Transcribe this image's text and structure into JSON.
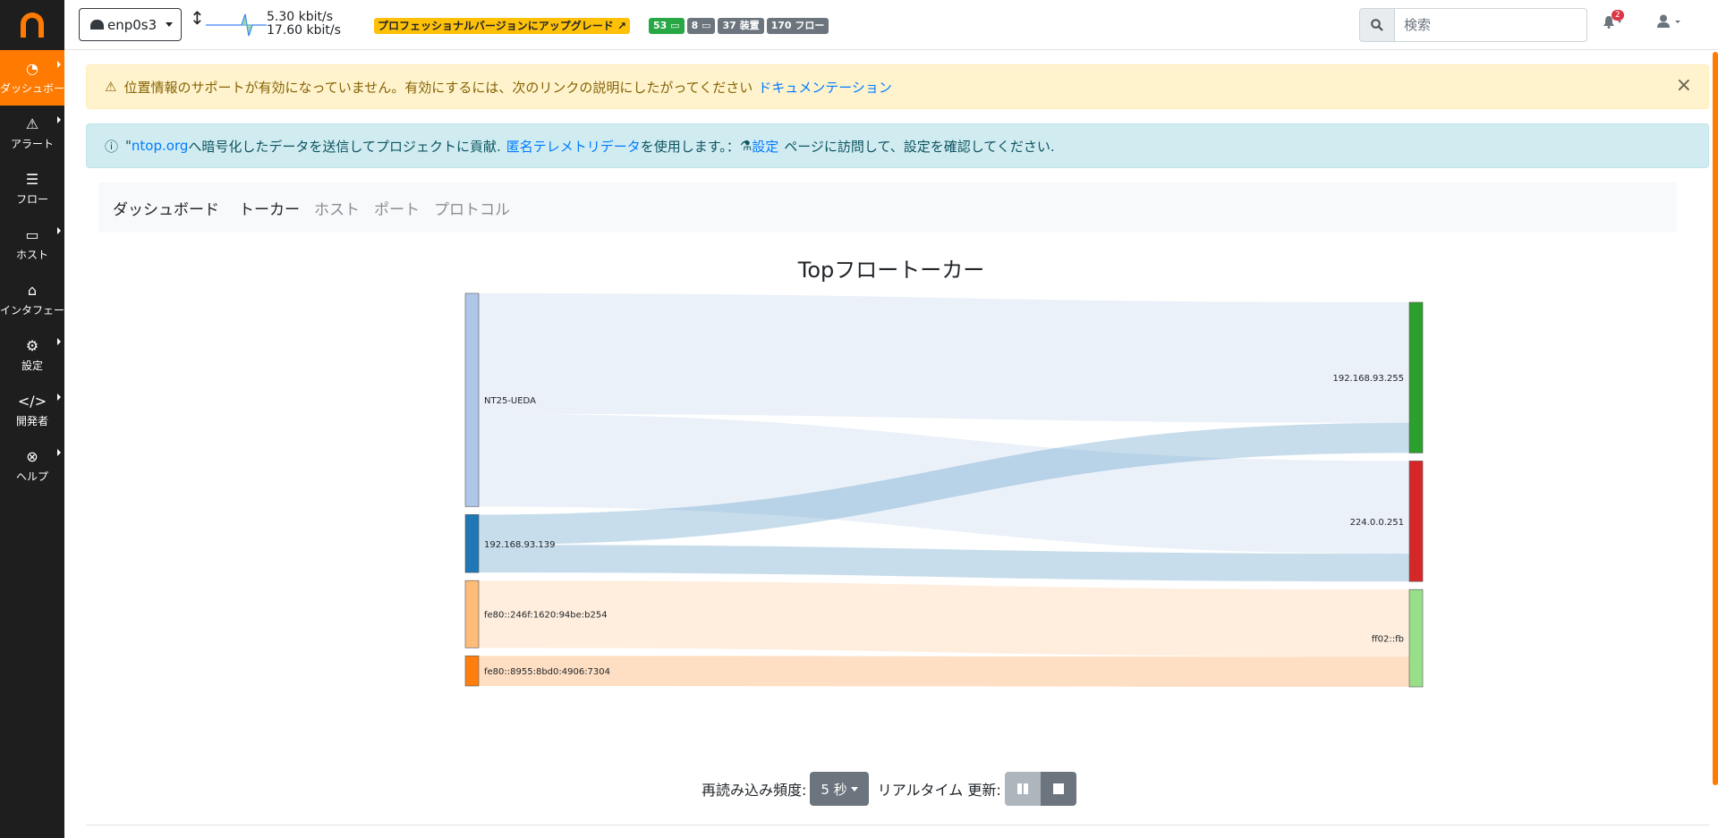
{
  "sidebar": {
    "logo_icon": "ntopng-logo",
    "items": [
      {
        "label": "ダッシュボード",
        "icon": "dashboard-icon",
        "active": true
      },
      {
        "label": "アラート",
        "icon": "alert-icon"
      },
      {
        "label": "フロー",
        "icon": "flows-icon"
      },
      {
        "label": "ホスト",
        "icon": "hosts-icon"
      },
      {
        "label": "インタフェース",
        "icon": "interface-icon"
      },
      {
        "label": "設定",
        "icon": "gear-icon"
      },
      {
        "label": "開発者",
        "icon": "code-icon"
      },
      {
        "label": "ヘルプ",
        "icon": "help-icon"
      }
    ]
  },
  "topbar": {
    "interface": "enp0s3",
    "rate_up": "5.30 kbit/s",
    "rate_down": "17.60 kbit/s",
    "upgrade_label": "プロフェッショナルバージョンにアップグレード",
    "badges": {
      "local_hosts": "53",
      "remote_hosts": "8",
      "devices": "37 装置",
      "flows": "170 フロー"
    },
    "search_placeholder": "検索",
    "notifications_count": "2"
  },
  "alerts": {
    "warning_text": "位置情報のサポートが有効になっていません。有効にするには、次のリンクの説明にしたがってください",
    "warning_link": "ドキュメンテーション",
    "info_link1": "ntop.org",
    "info_prefix": "\"",
    "info_text1": "へ暗号化したデータを送信してプロジェクトに貢献.",
    "info_link2": "匿名テレメトリデータ",
    "info_text2": "を使用します。：",
    "info_link3": "設定",
    "info_text3": "ページに訪問して、設定を確認してください."
  },
  "subnav": {
    "brand": "ダッシュボード",
    "tabs": [
      "トーカー",
      "ホスト",
      "ポート",
      "プロトコル"
    ],
    "active_tab": 0
  },
  "chart_data": {
    "type": "sankey",
    "title": "Topフロートーカー",
    "sources": [
      "NT25-UEDA",
      "192.168.93.139",
      "fe80::246f:1620:94be:b254",
      "fe80::8955:8bd0:4906:7304"
    ],
    "targets": [
      "192.168.93.255",
      "224.0.0.251",
      "ff02::fb"
    ],
    "source_colors": [
      "#aec7e8",
      "#1f77b4",
      "#ffbb78",
      "#ff7f0e"
    ],
    "target_colors": [
      "#2ca02c",
      "#d62728",
      "#98df8a"
    ],
    "links": [
      {
        "source": "NT25-UEDA",
        "target": "192.168.93.255",
        "value": 52
      },
      {
        "source": "NT25-UEDA",
        "target": "224.0.0.251",
        "value": 40
      },
      {
        "source": "192.168.93.139",
        "target": "192.168.93.255",
        "value": 13
      },
      {
        "source": "192.168.93.139",
        "target": "224.0.0.251",
        "value": 12
      },
      {
        "source": "fe80::246f:1620:94be:b254",
        "target": "ff02::fb",
        "value": 29
      },
      {
        "source": "fe80::8955:8bd0:4906:7304",
        "target": "ff02::fb",
        "value": 13
      }
    ]
  },
  "footer": {
    "refresh_label": "再読み込み頻度:",
    "refresh_value": "5 秒",
    "realtime_label": "リアルタイム 更新:"
  }
}
